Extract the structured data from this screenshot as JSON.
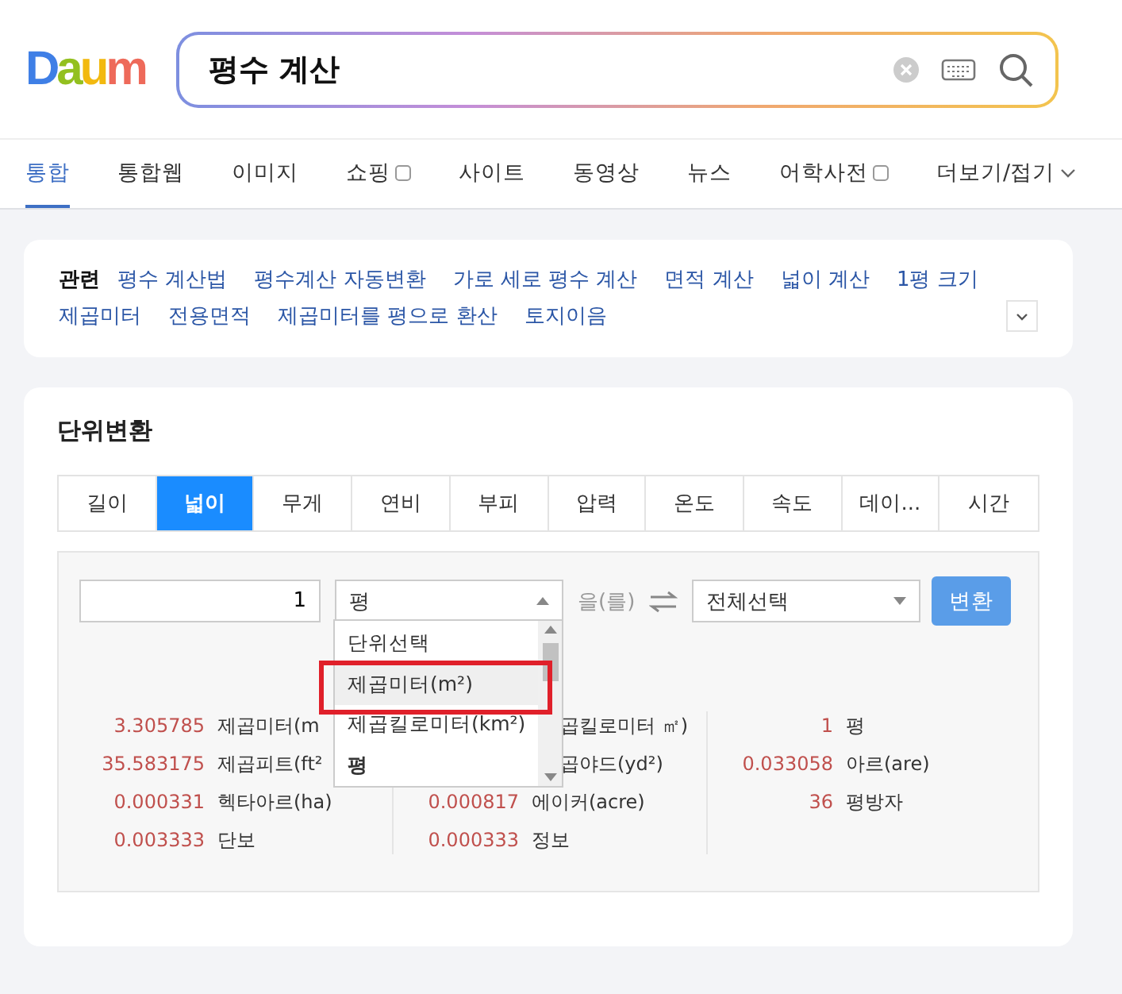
{
  "logo": "Daum",
  "search": {
    "value": "평수 계산"
  },
  "nav_tabs": [
    {
      "label": "통합",
      "selected": true,
      "kind": "link"
    },
    {
      "label": "통합웹",
      "selected": false,
      "kind": "link"
    },
    {
      "label": "이미지",
      "selected": false,
      "kind": "link"
    },
    {
      "label": "쇼핑",
      "selected": false,
      "kind": "external"
    },
    {
      "label": "사이트",
      "selected": false,
      "kind": "link"
    },
    {
      "label": "동영상",
      "selected": false,
      "kind": "link"
    },
    {
      "label": "뉴스",
      "selected": false,
      "kind": "link"
    },
    {
      "label": "어학사전",
      "selected": false,
      "kind": "external"
    },
    {
      "label": "더보기/접기",
      "selected": false,
      "kind": "more"
    }
  ],
  "related": {
    "label": "관련",
    "links": [
      "평수 계산법",
      "평수계산 자동변환",
      "가로 세로 평수 계산",
      "면적 계산",
      "넓이 계산",
      "1평 크기",
      "제곱미터",
      "전용면적",
      "제곱미터를 평으로 환산",
      "토지이음"
    ]
  },
  "converter": {
    "title": "단위변환",
    "tabs": [
      {
        "label": "길이",
        "selected": false
      },
      {
        "label": "넓이",
        "selected": true
      },
      {
        "label": "무게",
        "selected": false
      },
      {
        "label": "연비",
        "selected": false
      },
      {
        "label": "부피",
        "selected": false
      },
      {
        "label": "압력",
        "selected": false
      },
      {
        "label": "온도",
        "selected": false
      },
      {
        "label": "속도",
        "selected": false
      },
      {
        "label": "데이...",
        "selected": false
      },
      {
        "label": "시간",
        "selected": false
      }
    ],
    "amount": "1",
    "from_unit": "평",
    "particle": "을(를)",
    "to_unit": "전체선택",
    "convert_button": "변환",
    "dropdown": {
      "expanded": true,
      "options": [
        {
          "label": "단위선택",
          "selected": false,
          "marked": false,
          "current": false
        },
        {
          "label": "제곱미터(m²)",
          "selected": true,
          "marked": true,
          "current": false
        },
        {
          "label": "제곱킬로미터(km²)",
          "selected": false,
          "marked": false,
          "current": false
        },
        {
          "label": "평",
          "selected": false,
          "marked": false,
          "current": true
        }
      ]
    },
    "results": [
      [
        {
          "value": "3.305785",
          "label": "제곱미터(m"
        },
        {
          "value": "35.583175",
          "label": "제곱피트(ft²"
        },
        {
          "value": "0.000331",
          "label": "헥타아르(ha)"
        },
        {
          "value": "0.003333",
          "label": "단보"
        }
      ],
      [
        {
          "label": "곱킬로미터 ㎡)"
        },
        {
          "label": "곱야드(yd²)"
        },
        {
          "value": "0.000817",
          "label": "에이커(acre)"
        },
        {
          "value": "0.000333",
          "label": "정보"
        }
      ],
      [
        {
          "value": "1",
          "label": "평"
        },
        {
          "value": "0.033058",
          "label": "아르(are)"
        },
        {
          "value": "36",
          "label": "평방자"
        }
      ]
    ]
  }
}
